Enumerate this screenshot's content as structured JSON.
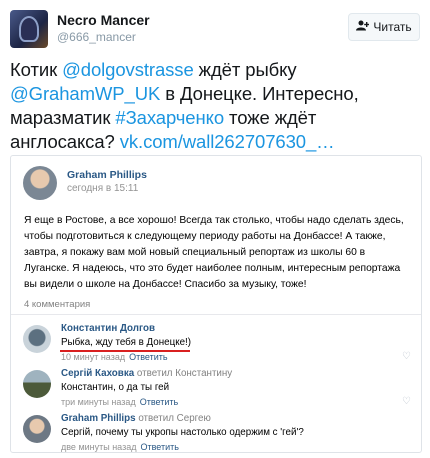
{
  "tweet": {
    "display_name": "Necro Mancer",
    "handle": "@666_mancer",
    "follow_label": "Читать",
    "text_parts": [
      {
        "t": "Котик ",
        "link": false
      },
      {
        "t": "@dolgovstrasse",
        "link": true
      },
      {
        "t": " ждёт рыбку ",
        "link": false
      },
      {
        "t": "@GrahamWP_UK",
        "link": true
      },
      {
        "t": " в Донецке. Интересно, маразматик ",
        "link": false
      },
      {
        "t": "#Захарченко",
        "link": true
      },
      {
        "t": " тоже ждёт англосакса? ",
        "link": false
      },
      {
        "t": "vk.com/wall262707630_…",
        "link": true
      }
    ]
  },
  "vk_post": {
    "author": "Graham Phillips",
    "date": "сегодня в 15:11",
    "body": "Я еще в Ростове, а все хорошо! Всегда так столько, чтобы надо сделать здесь, чтобы подготовиться к следующему периоду работы на Донбассе! А также, завтра, я покажу вам мой новый специальный репортаж из школы 60 в Луганске. Я надеюсь, что это будет наиболее полным, интересным репортажа вы видели о школе на Донбассе! Спасибо за музыку, тоже!",
    "comments_count": "4 комментария"
  },
  "comments": [
    {
      "author": "Константин Долгов",
      "reply_to": "",
      "text": "Рыбка, жду тебя в Донецке!)",
      "time": "10 минут назад",
      "answer": "Ответить",
      "like": "♡"
    },
    {
      "author": "Сергій Каховка",
      "reply_to": "ответил Константину",
      "text": "Константин, о да ты гей",
      "time": "три минуты назад",
      "answer": "Ответить",
      "like": "♡"
    },
    {
      "author": "Graham Phillips",
      "reply_to": "ответил Сергею",
      "text": "Сергій, почему ты укропы настолько одержим с 'гей'?",
      "time": "две минуты назад",
      "answer": "Ответить",
      "like": "♡"
    }
  ],
  "icons": {
    "follow": "add-user-icon",
    "like": "heart-icon"
  },
  "colors": {
    "link": "#1b95e0",
    "vk_link": "#2a5885",
    "highlight_underline": "#d92020"
  }
}
